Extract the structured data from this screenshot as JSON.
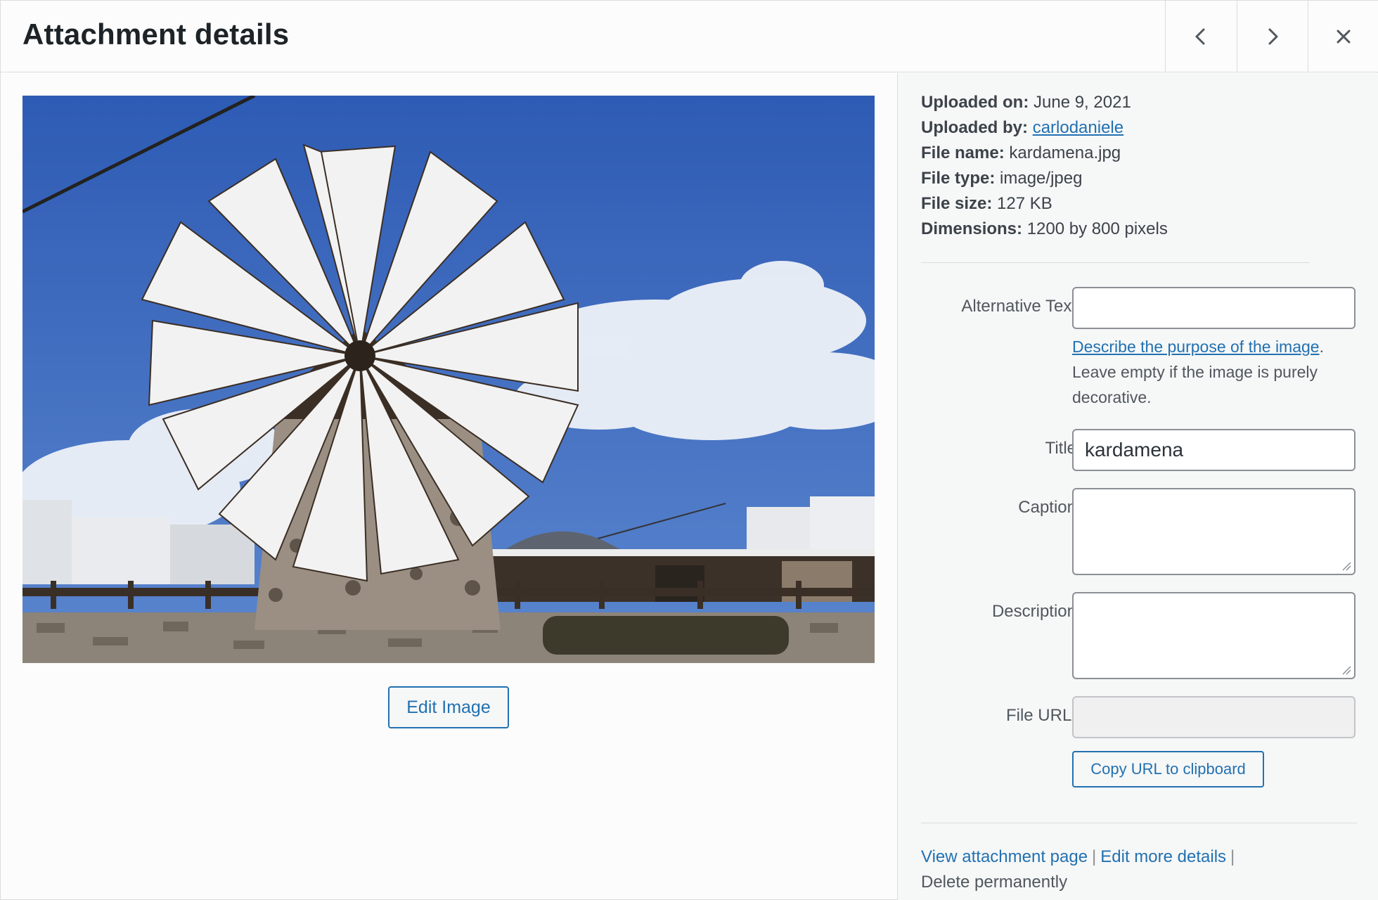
{
  "header": {
    "title": "Attachment details",
    "prev_label": "Previous",
    "next_label": "Next",
    "close_label": "Close"
  },
  "preview": {
    "image_alt": "kardamena",
    "edit_image_label": "Edit Image"
  },
  "meta": {
    "uploaded_on_label": "Uploaded on:",
    "uploaded_on": "June 9, 2021",
    "uploaded_by_label": "Uploaded by:",
    "uploaded_by": "carlodaniele",
    "file_name_label": "File name:",
    "file_name": "kardamena.jpg",
    "file_type_label": "File type:",
    "file_type": "image/jpeg",
    "file_size_label": "File size:",
    "file_size": "127 KB",
    "dimensions_label": "Dimensions:",
    "dimensions": "1200 by 800 pixels"
  },
  "form": {
    "alt_label": "Alternative Text",
    "alt_value": "",
    "alt_help_link": "Describe the purpose of the image",
    "alt_help_period": ".",
    "alt_help_text": "Leave empty if the image is purely decorative.",
    "title_label": "Title",
    "title_value": "kardamena",
    "caption_label": "Caption",
    "caption_value": "",
    "description_label": "Description",
    "description_value": "",
    "file_url_label": "File URL:",
    "file_url_value": "",
    "copy_url_label": "Copy URL to clipboard"
  },
  "actions": {
    "view_page": "View attachment page",
    "edit_details": "Edit more details",
    "separator": "|",
    "delete": "Delete permanently"
  },
  "colors": {
    "accent": "#2271b1",
    "sky": "#3a64b8",
    "sail": "#f2f2f2",
    "text": "#3c434a"
  }
}
